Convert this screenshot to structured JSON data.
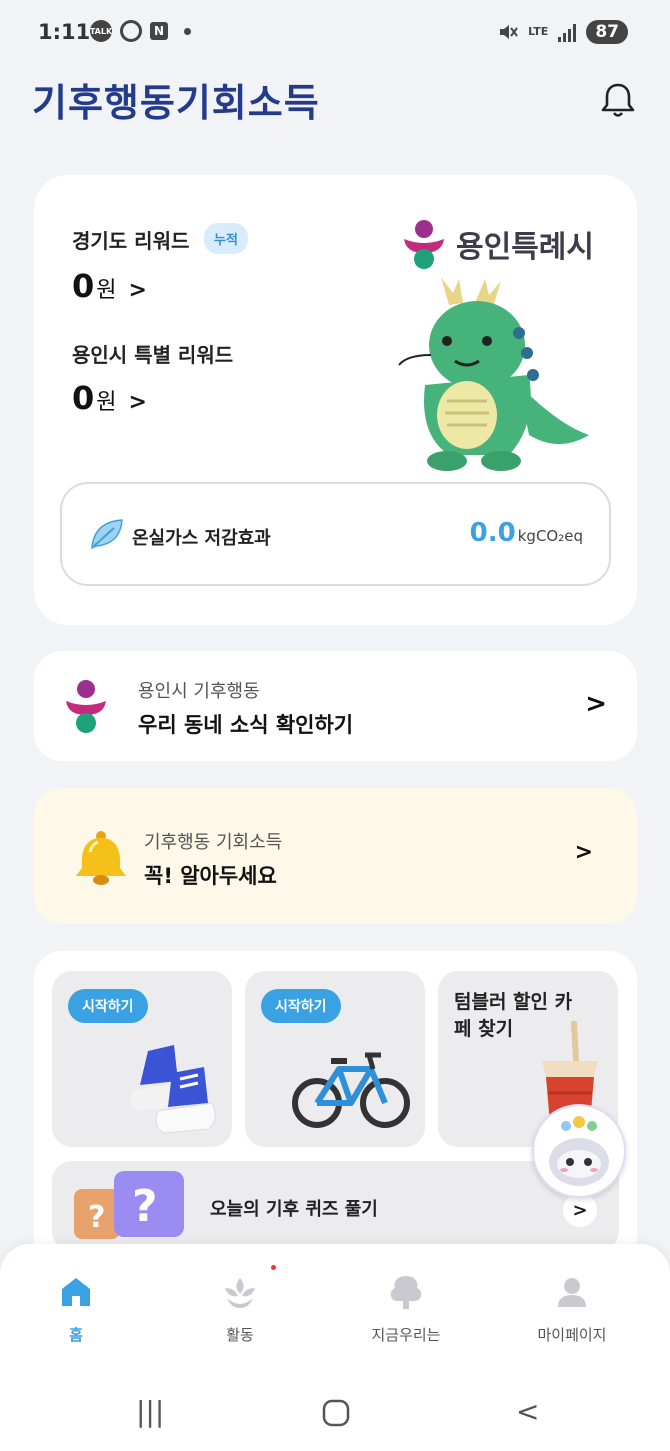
{
  "status_bar": {
    "time": "1:11",
    "left_icons": [
      "TALK",
      "",
      "N"
    ],
    "lte": "LTE",
    "battery": "87"
  },
  "header": {
    "logo": "기후행동기회소득",
    "logo_colors": {
      "main": "#233b8a",
      "accent": "#1aa0a0"
    }
  },
  "reward_card": {
    "gyeonggi_label": "경기도 리워드",
    "cumulative_badge": "누적",
    "gyeonggi_amount": "0",
    "currency": "원",
    "yongin_label": "용인시 특별 리워드",
    "yongin_amount": "0",
    "city_name": "용인특례시",
    "ghg_label": "온실가스 저감효과",
    "ghg_value": "0.0",
    "ghg_unit": "kgCO₂eq"
  },
  "news_card": {
    "subtitle": "용인시 기후행동",
    "title": "우리 동네 소식 확인하기"
  },
  "notice_card": {
    "subtitle": "기후행동 기회소득",
    "title": "꼭! 알아두세요"
  },
  "activities": {
    "walk_start": "시작하기",
    "bike_start": "시작하기",
    "tumbler_title": "텀블러 할인 카페 찾기",
    "quiz_label": "오늘의 기후 퀴즈 풀기"
  },
  "bottom_nav": {
    "items": [
      {
        "label": "홈",
        "active": true
      },
      {
        "label": "활동",
        "active": false
      },
      {
        "label": "지금우리는",
        "active": false
      },
      {
        "label": "마이페이지",
        "active": false
      }
    ],
    "accent": "#3aa2e2"
  }
}
